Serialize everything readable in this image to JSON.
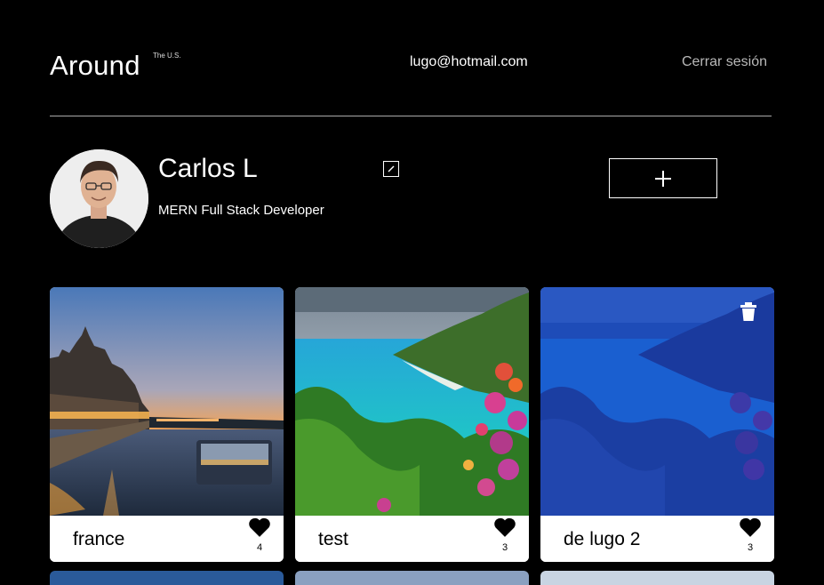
{
  "header": {
    "logo": "Around",
    "logo_sup": "The U.S.",
    "email": "lugo@hotmail.com",
    "logout": "Cerrar sesión"
  },
  "profile": {
    "name": "Carlos L",
    "role": "MERN Full Stack Developer",
    "edit_icon": "pencil-icon",
    "add_icon": "plus-icon"
  },
  "cards": [
    {
      "title": "france",
      "likes": "4",
      "liked": true
    },
    {
      "title": "test",
      "likes": "3",
      "liked": true
    },
    {
      "title": "de lugo 2",
      "likes": "3",
      "liked": true,
      "deletable": true
    }
  ],
  "colors": {
    "background": "#000000",
    "card": "#ffffff",
    "divider": "#a9a9a9",
    "muted_text": "#b9b9b9"
  }
}
